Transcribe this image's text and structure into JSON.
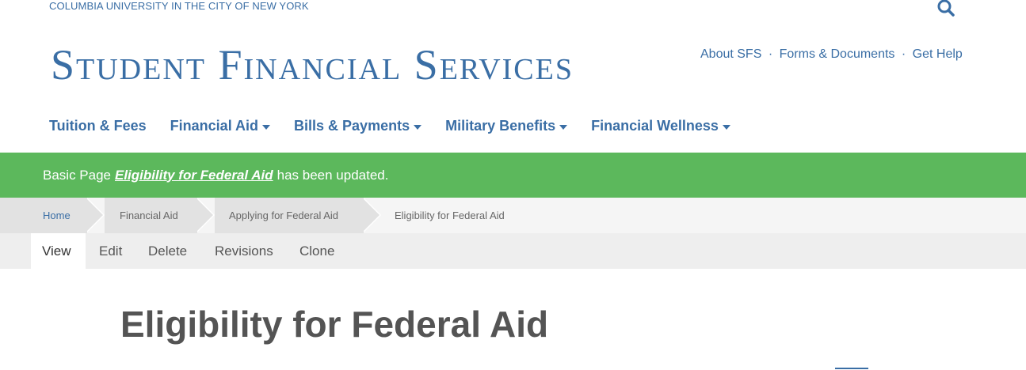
{
  "header": {
    "university": "COLUMBIA UNIVERSITY IN THE CITY OF NEW YORK",
    "site_title": "Student Financial Services",
    "search_icon": "search-icon"
  },
  "utility_nav": {
    "items": [
      "About SFS",
      "Forms & Documents",
      "Get Help"
    ],
    "separator": "·"
  },
  "main_nav": {
    "items": [
      {
        "label": "Tuition & Fees",
        "dropdown": false
      },
      {
        "label": "Financial Aid",
        "dropdown": true
      },
      {
        "label": "Bills & Payments",
        "dropdown": true
      },
      {
        "label": "Military Benefits",
        "dropdown": true
      },
      {
        "label": "Financial Wellness",
        "dropdown": true
      }
    ]
  },
  "alert": {
    "prefix": "Basic Page",
    "link": "Eligibility for Federal Aid",
    "suffix": "has been updated.",
    "color": "#5cb85c"
  },
  "breadcrumb": {
    "items": [
      "Home",
      "Financial Aid",
      "Applying for Federal Aid",
      "Eligibility for Federal Aid"
    ]
  },
  "tabs": {
    "items": [
      "View",
      "Edit",
      "Delete",
      "Revisions",
      "Clone"
    ],
    "active": "View"
  },
  "page": {
    "title": "Eligibility for Federal Aid"
  },
  "colors": {
    "brand": "#3a6ea5",
    "alert_green": "#5cb85c",
    "title_gray": "#545454"
  }
}
